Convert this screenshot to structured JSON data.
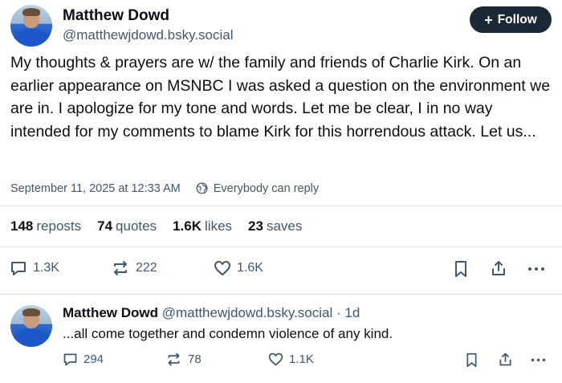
{
  "post": {
    "author_name": "Matthew Dowd",
    "author_handle": "@matthewjdowd.bsky.social",
    "follow_label": "Follow",
    "text": "My thoughts & prayers are w/ the family and friends of Charlie Kirk.  On an earlier appearance on MSNBC I was asked a question on the environment we are in.  I apologize for my tone and words.  Let me be clear, I in no way intended for my comments to blame Kirk for this horrendous attack.  Let us...",
    "timestamp": "September 11, 2025 at 12:33 AM",
    "reply_setting": "Everybody can reply",
    "stats": {
      "reposts_count": "148",
      "reposts_label": "reposts",
      "quotes_count": "74",
      "quotes_label": "quotes",
      "likes_count": "1.6K",
      "likes_label": "likes",
      "saves_count": "23",
      "saves_label": "saves"
    },
    "actions": {
      "replies": "1.3K",
      "reposts": "222",
      "likes": "1.6K"
    }
  },
  "reply": {
    "author_name": "Matthew Dowd",
    "author_handle": "@matthewjdowd.bsky.social",
    "age": "· 1d",
    "text": "...all come together and condemn violence of any kind.",
    "actions": {
      "replies": "294",
      "reposts": "78",
      "likes": "1.1K"
    }
  },
  "icons": {
    "follow": "plus-icon",
    "reply_setting": "globe-icon",
    "reply": "speech-bubble-icon",
    "repost": "repost-icon",
    "like": "heart-icon",
    "bookmark": "bookmark-icon",
    "share": "share-icon",
    "more": "ellipsis-icon"
  },
  "colors": {
    "text_primary": "#0b0f14",
    "text_secondary": "#42576c",
    "follow_button_bg": "#1b2836",
    "divider": "#dfe4ea"
  }
}
